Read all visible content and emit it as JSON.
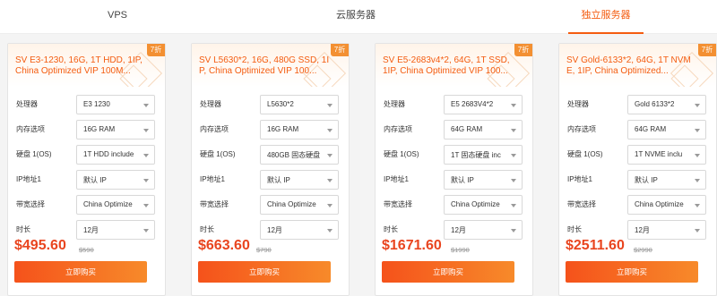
{
  "tabs": [
    {
      "label": "VPS",
      "active": false
    },
    {
      "label": "云服务器",
      "active": false
    },
    {
      "label": "独立服务器",
      "active": true
    }
  ],
  "accent_color": "#f45c10",
  "price_color": "#e9451f",
  "field_labels": {
    "cpu": "处理器",
    "memory": "内存选项",
    "disk": "硬盘 1(OS)",
    "ip": "IP地址1",
    "bandwidth": "带宽选择",
    "duration": "时长"
  },
  "cards": [
    {
      "badge": "7折",
      "title": "SV E3-1230, 16G, 1T HDD, 1IP, China Optimized VIP 100M...",
      "cpu": "E3 1230",
      "memory": "16G RAM",
      "disk": "1T HDD  include",
      "ip": "默认 IP",
      "bandwidth": "China Optimize",
      "duration": "12月",
      "price": "$495.60",
      "old_price": "$590",
      "buy_label": "立即购买"
    },
    {
      "badge": "7折",
      "title": "SV L5630*2, 16G, 480G SSD, 1IP, China Optimized VIP 100...",
      "cpu": "L5630*2",
      "memory": "16G RAM",
      "disk": "480GB 固态硬盘",
      "ip": "默认 IP",
      "bandwidth": "China Optimize",
      "duration": "12月",
      "price": "$663.60",
      "old_price": "$790",
      "buy_label": "立即购买"
    },
    {
      "badge": "7折",
      "title": "SV E5-2683v4*2, 64G, 1T SSD, 1IP, China Optimized VIP 100...",
      "cpu": "E5 2683V4*2",
      "memory": "64G RAM",
      "disk": "1T 固态硬盘  inc",
      "ip": "默认 IP",
      "bandwidth": "China Optimize",
      "duration": "12月",
      "price": "$1671.60",
      "old_price": "$1990",
      "buy_label": "立即购买"
    },
    {
      "badge": "7折",
      "title": "SV Gold-6133*2, 64G, 1T NVME, 1IP, China Optimized...",
      "cpu": "Gold 6133*2",
      "memory": "64G RAM",
      "disk": "1T NVME  inclu",
      "ip": "默认 IP",
      "bandwidth": "China Optimize",
      "duration": "12月",
      "price": "$2511.60",
      "old_price": "$2990",
      "buy_label": "立即购买"
    }
  ]
}
